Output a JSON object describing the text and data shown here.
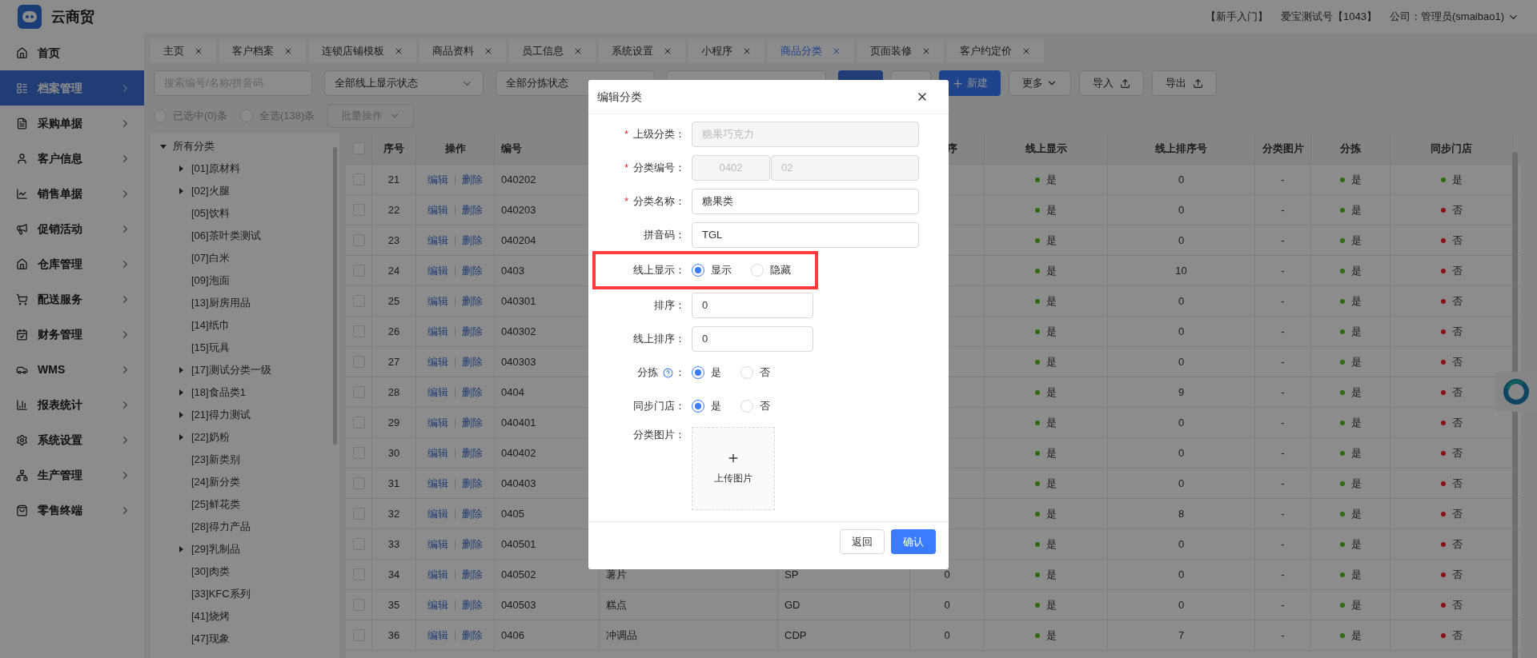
{
  "app": {
    "name": "云商贸"
  },
  "header_links": [
    "【新手入门】",
    "爱宝测试号【1043】",
    "公司：管理员(smaibao1)"
  ],
  "sidebar": [
    {
      "label": "首页",
      "selected": false,
      "expandable": false
    },
    {
      "label": "档案管理",
      "selected": true,
      "expandable": true
    },
    {
      "label": "采购单据",
      "selected": false,
      "expandable": true
    },
    {
      "label": "客户信息",
      "selected": false,
      "expandable": true
    },
    {
      "label": "销售单据",
      "selected": false,
      "expandable": true
    },
    {
      "label": "促销活动",
      "selected": false,
      "expandable": true
    },
    {
      "label": "仓库管理",
      "selected": false,
      "expandable": true
    },
    {
      "label": "配送服务",
      "selected": false,
      "expandable": true
    },
    {
      "label": "财务管理",
      "selected": false,
      "expandable": true
    },
    {
      "label": "WMS",
      "selected": false,
      "expandable": true
    },
    {
      "label": "报表统计",
      "selected": false,
      "expandable": true
    },
    {
      "label": "系统设置",
      "selected": false,
      "expandable": true
    },
    {
      "label": "生产管理",
      "selected": false,
      "expandable": true
    },
    {
      "label": "零售终端",
      "selected": false,
      "expandable": true
    }
  ],
  "tabs": [
    {
      "label": "主页",
      "selected": false
    },
    {
      "label": "客户档案",
      "selected": false
    },
    {
      "label": "连锁店铺模板",
      "selected": false
    },
    {
      "label": "商品资料",
      "selected": false
    },
    {
      "label": "员工信息",
      "selected": false
    },
    {
      "label": "系统设置",
      "selected": false
    },
    {
      "label": "小程序",
      "selected": false
    },
    {
      "label": "商品分类",
      "selected": true
    },
    {
      "label": "页面装修",
      "selected": false
    },
    {
      "label": "客户约定价",
      "selected": false
    }
  ],
  "filters": {
    "search": {
      "placeholder": "搜索编号/名称/拼音码"
    },
    "selects": [
      {
        "value": "全部线上显示状态"
      },
      {
        "value": "全部分拣状态"
      }
    ]
  },
  "toolbar": [
    {
      "kind": "primary"
    },
    {
      "kind": "plain"
    },
    {
      "kind": "create",
      "label": "新建"
    },
    {
      "kind": "dropdown",
      "label": "更多"
    },
    {
      "kind": "import",
      "label": "导入"
    },
    {
      "kind": "export",
      "label": "导出"
    }
  ],
  "selection": {
    "options": [
      {
        "label": "已选中(0)条",
        "selected": false
      },
      {
        "label": "全选(138)条",
        "selected": false
      }
    ],
    "batch": {
      "label": "批量操作",
      "disabled": true
    }
  },
  "tree": {
    "label": "所有分类",
    "expanded": true,
    "children": [
      {
        "label": "[01]原材料",
        "kind": "branch",
        "expanded": false
      },
      {
        "label": "[02]火腿",
        "kind": "branch",
        "expanded": false
      },
      {
        "label": "[05]饮料",
        "kind": "leaf"
      },
      {
        "label": "[06]茶叶类测试",
        "kind": "leaf"
      },
      {
        "label": "[07]白米",
        "kind": "leaf"
      },
      {
        "label": "[09]泡面",
        "kind": "leaf"
      },
      {
        "label": "[13]厨房用品",
        "kind": "leaf"
      },
      {
        "label": "[14]纸巾",
        "kind": "leaf"
      },
      {
        "label": "[15]玩具",
        "kind": "leaf"
      },
      {
        "label": "[17]测试分类一级",
        "kind": "branch",
        "expanded": false
      },
      {
        "label": "[18]食品类1",
        "kind": "branch",
        "expanded": false
      },
      {
        "label": "[21]得力测试",
        "kind": "branch",
        "expanded": false
      },
      {
        "label": "[22]奶粉",
        "kind": "branch",
        "expanded": false
      },
      {
        "label": "[23]新类别",
        "kind": "leaf"
      },
      {
        "label": "[24]新分类",
        "kind": "leaf"
      },
      {
        "label": "[25]鲜花类",
        "kind": "leaf"
      },
      {
        "label": "[28]得力产品",
        "kind": "leaf"
      },
      {
        "label": "[29]乳制品",
        "kind": "branch",
        "expanded": false
      },
      {
        "label": "[30]肉类",
        "kind": "leaf"
      },
      {
        "label": "[33]KFC系列",
        "kind": "leaf"
      },
      {
        "label": "[41]烧烤",
        "kind": "leaf"
      },
      {
        "label": "[47]现象",
        "kind": "leaf"
      }
    ]
  },
  "table": {
    "columns": [
      "序号",
      "操作",
      "编号",
      "序",
      "线上显示",
      "线上排序号",
      "分类图片",
      "分拣",
      "同步门店"
    ],
    "header_checked": false,
    "rows": [
      {
        "checked": false,
        "no": "21",
        "actions": [
          "编辑",
          "删除"
        ],
        "code": "040202",
        "online": {
          "text": "是",
          "color": "#2d6c0e"
        },
        "online_sort": "0",
        "image": "-",
        "pick": {
          "text": "是",
          "color": "#2d6c0e"
        },
        "sync": {
          "text": "是",
          "color": "#2d6c0e"
        }
      },
      {
        "checked": false,
        "no": "22",
        "actions": [
          "编辑",
          "删除"
        ],
        "code": "040203",
        "online": {
          "text": "是",
          "color": "#2d6c0e"
        },
        "online_sort": "0",
        "image": "-",
        "pick": {
          "text": "是",
          "color": "#2d6c0e"
        },
        "sync": {
          "text": "否",
          "color": "#871319"
        }
      },
      {
        "checked": false,
        "no": "23",
        "actions": [
          "编辑",
          "删除"
        ],
        "code": "040204",
        "online": {
          "text": "是",
          "color": "#2d6c0e"
        },
        "online_sort": "0",
        "image": "-",
        "pick": {
          "text": "是",
          "color": "#2d6c0e"
        },
        "sync": {
          "text": "否",
          "color": "#871319"
        }
      },
      {
        "checked": false,
        "no": "24",
        "actions": [
          "编辑",
          "删除"
        ],
        "code": "0403",
        "online": {
          "text": "是",
          "color": "#2d6c0e"
        },
        "online_sort": "10",
        "image": "-",
        "pick": {
          "text": "是",
          "color": "#2d6c0e"
        },
        "sync": {
          "text": "否",
          "color": "#871319"
        }
      },
      {
        "checked": false,
        "no": "25",
        "actions": [
          "编辑",
          "删除"
        ],
        "code": "040301",
        "online": {
          "text": "是",
          "color": "#2d6c0e"
        },
        "online_sort": "0",
        "image": "-",
        "pick": {
          "text": "是",
          "color": "#2d6c0e"
        },
        "sync": {
          "text": "否",
          "color": "#871319"
        }
      },
      {
        "checked": false,
        "no": "26",
        "actions": [
          "编辑",
          "删除"
        ],
        "code": "040302",
        "online": {
          "text": "是",
          "color": "#2d6c0e"
        },
        "online_sort": "0",
        "image": "-",
        "pick": {
          "text": "是",
          "color": "#2d6c0e"
        },
        "sync": {
          "text": "否",
          "color": "#871319"
        }
      },
      {
        "checked": false,
        "no": "27",
        "actions": [
          "编辑",
          "删除"
        ],
        "code": "040303",
        "online": {
          "text": "是",
          "color": "#2d6c0e"
        },
        "online_sort": "0",
        "image": "-",
        "pick": {
          "text": "是",
          "color": "#2d6c0e"
        },
        "sync": {
          "text": "否",
          "color": "#871319"
        }
      },
      {
        "checked": false,
        "no": "28",
        "actions": [
          "编辑",
          "删除"
        ],
        "code": "0404",
        "online": {
          "text": "是",
          "color": "#2d6c0e"
        },
        "online_sort": "9",
        "image": "-",
        "pick": {
          "text": "是",
          "color": "#2d6c0e"
        },
        "sync": {
          "text": "否",
          "color": "#871319"
        }
      },
      {
        "checked": false,
        "no": "29",
        "actions": [
          "编辑",
          "删除"
        ],
        "code": "040401",
        "online": {
          "text": "是",
          "color": "#2d6c0e"
        },
        "online_sort": "0",
        "image": "-",
        "pick": {
          "text": "是",
          "color": "#2d6c0e"
        },
        "sync": {
          "text": "否",
          "color": "#871319"
        }
      },
      {
        "checked": false,
        "no": "30",
        "actions": [
          "编辑",
          "删除"
        ],
        "code": "040402",
        "online": {
          "text": "是",
          "color": "#2d6c0e"
        },
        "online_sort": "0",
        "image": "-",
        "pick": {
          "text": "是",
          "color": "#2d6c0e"
        },
        "sync": {
          "text": "否",
          "color": "#871319"
        }
      },
      {
        "checked": false,
        "no": "31",
        "actions": [
          "编辑",
          "删除"
        ],
        "code": "040403",
        "online": {
          "text": "是",
          "color": "#2d6c0e"
        },
        "online_sort": "0",
        "image": "-",
        "pick": {
          "text": "是",
          "color": "#2d6c0e"
        },
        "sync": {
          "text": "否",
          "color": "#871319"
        }
      },
      {
        "checked": false,
        "no": "32",
        "actions": [
          "编辑",
          "删除"
        ],
        "code": "0405",
        "online": {
          "text": "是",
          "color": "#2d6c0e"
        },
        "online_sort": "8",
        "image": "-",
        "pick": {
          "text": "是",
          "color": "#2d6c0e"
        },
        "sync": {
          "text": "否",
          "color": "#871319"
        }
      },
      {
        "checked": false,
        "no": "33",
        "actions": [
          "编辑",
          "删除"
        ],
        "code": "040501",
        "online": {
          "text": "是",
          "color": "#2d6c0e"
        },
        "online_sort": "0",
        "image": "-",
        "pick": {
          "text": "是",
          "color": "#2d6c0e"
        },
        "sync": {
          "text": "否",
          "color": "#871319"
        }
      },
      {
        "checked": false,
        "no": "34",
        "actions": [
          "编辑",
          "删除"
        ],
        "code": "040502",
        "name": "薯片",
        "pinyin": "SP",
        "sort": "0",
        "online": {
          "text": "是",
          "color": "#2d6c0e"
        },
        "online_sort": "0",
        "image": "-",
        "pick": {
          "text": "是",
          "color": "#2d6c0e"
        },
        "sync": {
          "text": "否",
          "color": "#871319"
        }
      },
      {
        "checked": false,
        "no": "35",
        "actions": [
          "编辑",
          "删除"
        ],
        "code": "040503",
        "name": "糕点",
        "pinyin": "GD",
        "sort": "0",
        "online": {
          "text": "是",
          "color": "#2d6c0e"
        },
        "online_sort": "0",
        "image": "-",
        "pick": {
          "text": "是",
          "color": "#2d6c0e"
        },
        "sync": {
          "text": "否",
          "color": "#871319"
        }
      },
      {
        "checked": false,
        "no": "36",
        "actions": [
          "编辑",
          "删除"
        ],
        "code": "0406",
        "name": "冲调品",
        "pinyin": "CDP",
        "sort": "0",
        "online": {
          "text": "是",
          "color": "#2d6c0e"
        },
        "online_sort": "7",
        "image": "-",
        "pick": {
          "text": "是",
          "color": "#2d6c0e"
        },
        "sync": {
          "text": "否",
          "color": "#871319"
        }
      }
    ]
  },
  "dialog": {
    "title": "编辑分类",
    "fields": [
      {
        "kind": "text",
        "label": "上级分类：",
        "required_mark": "*",
        "value": "糖果巧克力",
        "disabled": true
      },
      {
        "kind": "pair",
        "label": "分类编号：",
        "required_mark": "*",
        "values": [
          "0402",
          "02"
        ],
        "disabled": true
      },
      {
        "kind": "text",
        "label": "分类名称：",
        "required_mark": "*",
        "value": "糖果类",
        "disabled": false
      },
      {
        "kind": "text",
        "label": "拼音码：",
        "value": "TGL",
        "disabled": false
      },
      {
        "kind": "radio",
        "label": "线上显示：",
        "highlighted": true,
        "options": [
          {
            "label": "显示",
            "selected": true
          },
          {
            "label": "隐藏",
            "selected": false
          }
        ]
      },
      {
        "kind": "short",
        "label": "排序：",
        "value": "0",
        "disabled": false
      },
      {
        "kind": "short",
        "label": "线上排序：",
        "value": "0",
        "disabled": false
      },
      {
        "kind": "radio",
        "label": "分拣",
        "help": true,
        "suffix": "：",
        "highlighted": false,
        "options": [
          {
            "label": "是",
            "selected": true
          },
          {
            "label": "否",
            "selected": false
          }
        ]
      },
      {
        "kind": "radio",
        "label": "同步门店：",
        "highlighted": false,
        "options": [
          {
            "label": "是",
            "selected": true
          },
          {
            "label": "否",
            "selected": false
          }
        ]
      },
      {
        "kind": "upload",
        "label": "分类图片：",
        "text": "上传图片"
      }
    ],
    "buttons": [
      {
        "kind": "default",
        "label": "返回"
      },
      {
        "kind": "primary",
        "label": "确认"
      }
    ]
  }
}
